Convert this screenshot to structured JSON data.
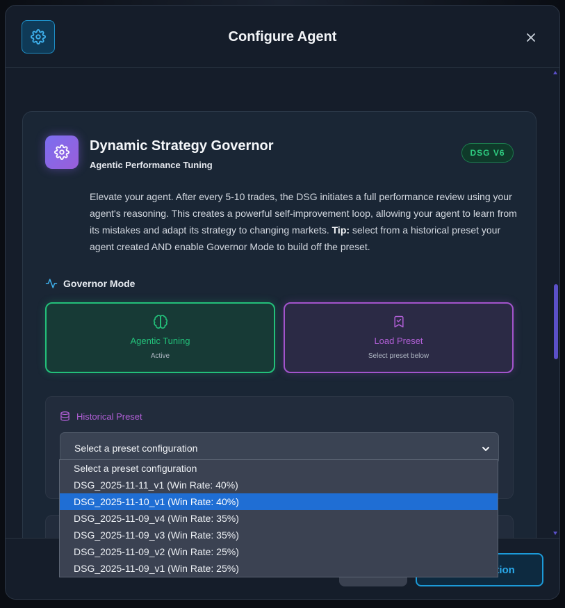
{
  "modal": {
    "title": "Configure Agent",
    "header_icon": "gear-icon",
    "close_icon": "close-icon"
  },
  "dsg": {
    "title": "Dynamic Strategy Governor",
    "subtitle": "Agentic Performance Tuning",
    "badge": "DSG V6",
    "description_intro": "Elevate your agent. After every 5-10 trades, the DSG initiates a full performance review using your agent's reasoning. This creates a powerful self-improvement loop, allowing your agent to learn from its mistakes and adapt its strategy to changing markets.",
    "tip_label": "Tip:",
    "tip_text": "select from a historical preset your agent created AND enable Governor Mode to build off the preset."
  },
  "governor_mode": {
    "label": "Governor Mode",
    "icon": "activity-pulse-icon",
    "options": [
      {
        "title": "Agentic Tuning",
        "subtitle": "Active",
        "icon": "brain-icon",
        "color": "#23c07a"
      },
      {
        "title": "Load Preset",
        "subtitle": "Select preset below",
        "icon": "bookmark-check-icon",
        "color": "#b15fd6"
      }
    ]
  },
  "historical_preset": {
    "label": "Historical Preset",
    "icon": "database-icon",
    "select_value": "Select a preset configuration",
    "options": [
      "Select a preset configuration",
      "DSG_2025-11-11_v1 (Win Rate: 40%)",
      "DSG_2025-11-10_v1 (Win Rate: 40%)",
      "DSG_2025-11-09_v4 (Win Rate: 35%)",
      "DSG_2025-11-09_v3 (Win Rate: 35%)",
      "DSG_2025-11-09_v2 (Win Rate: 25%)",
      "DSG_2025-11-09_v1 (Win Rate: 25%)"
    ],
    "highlighted_index": 2
  },
  "footer": {
    "save_label": "ration"
  },
  "colors": {
    "accent_blue": "#2aa9ea",
    "accent_green": "#23c07a",
    "accent_purple": "#b15fd6",
    "dropdown_highlight": "#1f6ed4"
  }
}
